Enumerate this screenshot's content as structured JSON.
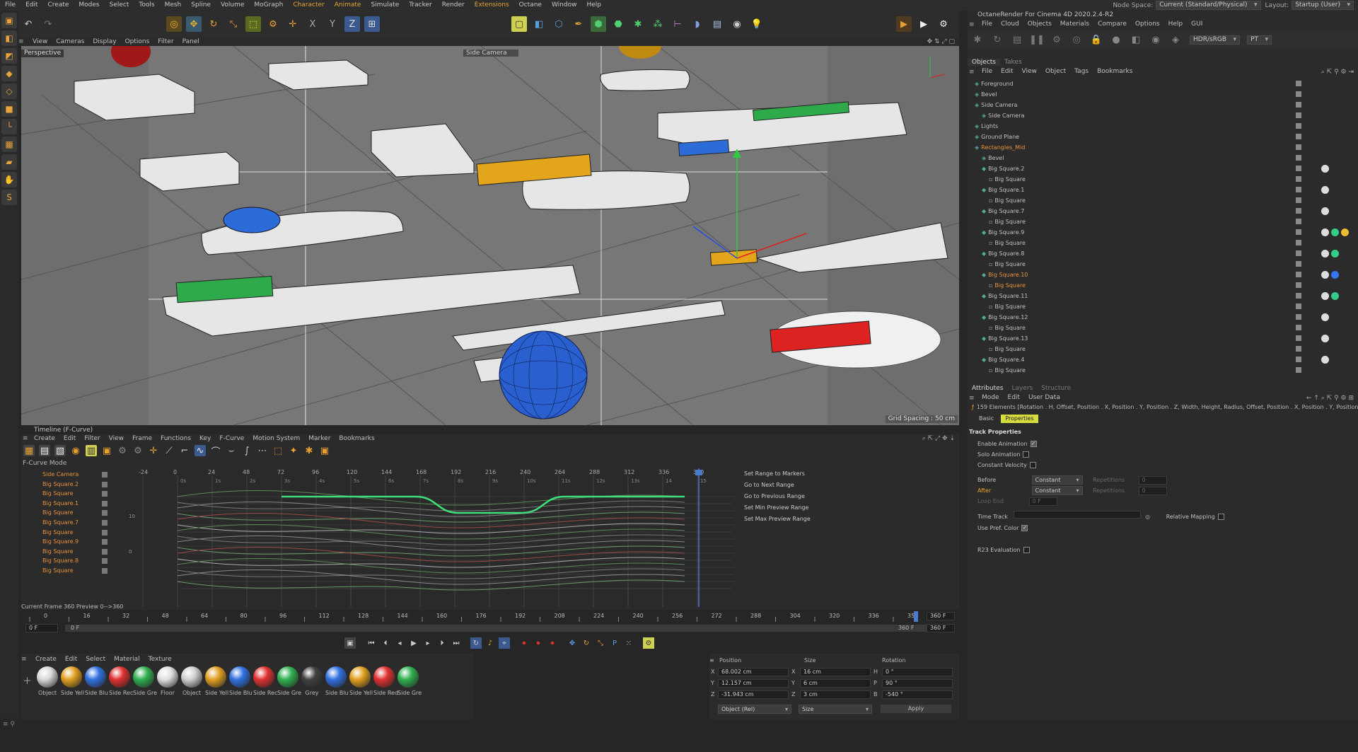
{
  "menubar": {
    "items": [
      "File",
      "Edit",
      "Create",
      "Modes",
      "Select",
      "Tools",
      "Mesh",
      "Spline",
      "Volume",
      "MoGraph",
      "Character",
      "Animate",
      "Simulate",
      "Tracker",
      "Render",
      "Extensions",
      "Octane",
      "Window",
      "Help"
    ],
    "nodespace_label": "Node Space:",
    "nodespace_value": "Current (Standard/Physical)",
    "layout_label": "Layout:",
    "layout_value": "Startup (User)"
  },
  "viewport": {
    "menu": [
      "View",
      "Cameras",
      "Display",
      "Options",
      "Filter",
      "Panel"
    ],
    "label": "Perspective",
    "camera": "Side Camera",
    "grid_spacing": "Grid Spacing : 50 cm"
  },
  "timeline": {
    "title": "Timeline (F-Curve)",
    "menu": [
      "Create",
      "Edit",
      "Filter",
      "View",
      "Frame",
      "Functions",
      "Key",
      "F-Curve",
      "Motion System",
      "Marker",
      "Bookmarks"
    ],
    "mode": "F-Curve Mode",
    "tracks": [
      "Side Camera",
      "Big Square.2",
      "Big Square",
      "Big Square.1",
      "Big Square",
      "Big Square.7",
      "Big Square",
      "Big Square.9",
      "Big Square",
      "Big Square.8",
      "Big Square"
    ],
    "top_ticks": [
      "-24",
      "0",
      "24",
      "48",
      "72",
      "96",
      "120",
      "144",
      "168",
      "192",
      "216",
      "240",
      "264",
      "288",
      "312",
      "336",
      "360"
    ],
    "sec_ticks": [
      "0s",
      "1s",
      "2s",
      "3s",
      "4s",
      "5s",
      "6s",
      "7s",
      "8s",
      "9s",
      "10s",
      "11s",
      "12s",
      "13s",
      "14",
      "15"
    ],
    "y_ticks": [
      "10",
      "0"
    ],
    "side_actions": [
      "Set Range to Markers",
      "Go to Next Range",
      "Go to Previous Range",
      "Set Min Preview Range",
      "Set Max Preview Range"
    ],
    "frame_info": "Current Frame  360  Preview  0-->360",
    "ruler_ticks": [
      "0",
      "16",
      "32",
      "48",
      "64",
      "80",
      "96",
      "112",
      "128",
      "144",
      "160",
      "176",
      "192",
      "208",
      "224",
      "240",
      "256",
      "272",
      "288",
      "304",
      "320",
      "336",
      "352"
    ],
    "ruler_end": "360 F",
    "start_field": "0 F",
    "preview_start": "0 F",
    "preview_end": "360 F",
    "end_field": "360 F"
  },
  "materials": {
    "menu": [
      "Create",
      "Edit",
      "Select",
      "Material",
      "Texture"
    ],
    "items": [
      {
        "name": "Object",
        "color": "#d8d8d8"
      },
      {
        "name": "Side Yell",
        "color": "#e0a020"
      },
      {
        "name": "Side Blu",
        "color": "#3070e0"
      },
      {
        "name": "Side Rec",
        "color": "#e03030"
      },
      {
        "name": "Side Gre",
        "color": "#30b050"
      },
      {
        "name": "Floor",
        "color": "#e0e0e0"
      },
      {
        "name": "Object",
        "color": "#d0d0d0"
      },
      {
        "name": "Side Yell",
        "color": "#e0a020"
      },
      {
        "name": "Side Blu",
        "color": "#3070e0"
      },
      {
        "name": "Side Rec",
        "color": "#e03030"
      },
      {
        "name": "Side Gre",
        "color": "#30b050"
      },
      {
        "name": "Grey",
        "color": "#404040"
      },
      {
        "name": "Side Blu",
        "color": "#3070e0"
      },
      {
        "name": "Side Yell",
        "color": "#e0a020"
      },
      {
        "name": "Side Red",
        "color": "#e03030"
      },
      {
        "name": "Side Gre",
        "color": "#30b050"
      }
    ]
  },
  "coords": {
    "headers": [
      "Position",
      "Size",
      "Rotation"
    ],
    "rows": [
      {
        "axis": "X",
        "pos": "68.002 cm",
        "saxis": "X",
        "size": "16 cm",
        "raxis": "H",
        "rot": "0 °"
      },
      {
        "axis": "Y",
        "pos": "12.157 cm",
        "saxis": "Y",
        "size": "6 cm",
        "raxis": "P",
        "rot": "90 °"
      },
      {
        "axis": "Z",
        "pos": "-31.943 cm",
        "saxis": "Z",
        "size": "3 cm",
        "raxis": "B",
        "rot": "-540 °"
      }
    ],
    "mode": "Object (Rel)",
    "size_mode": "Size",
    "apply": "Apply"
  },
  "octane": {
    "title": "OctaneRender For Cinema 4D 2020.2.4-R2",
    "menu": [
      "File",
      "Cloud",
      "Objects",
      "Materials",
      "Compare",
      "Options",
      "Help",
      "GUI"
    ],
    "color_space": "HDR/sRGB",
    "kernel": "PT"
  },
  "objects": {
    "tabs": [
      "Objects",
      "Takes"
    ],
    "menu": [
      "File",
      "Edit",
      "View",
      "Object",
      "Tags",
      "Bookmarks"
    ],
    "rows": [
      {
        "name": "Foreground",
        "indent": 0
      },
      {
        "name": "Bevel",
        "indent": 0
      },
      {
        "name": "Side Camera",
        "indent": 0
      },
      {
        "name": "Side Camera",
        "indent": 1
      },
      {
        "name": "Lights",
        "indent": 0
      },
      {
        "name": "Ground Plane",
        "indent": 0
      },
      {
        "name": "Rectangles_Mid",
        "indent": 0,
        "hl": true
      },
      {
        "name": "Bevel",
        "indent": 1
      },
      {
        "name": "Big Square.2",
        "indent": 1
      },
      {
        "name": "Big Square",
        "indent": 2
      },
      {
        "name": "Big Square.1",
        "indent": 1
      },
      {
        "name": "Big Square",
        "indent": 2
      },
      {
        "name": "Big Square.7",
        "indent": 1
      },
      {
        "name": "Big Square",
        "indent": 2
      },
      {
        "name": "Big Square.9",
        "indent": 1
      },
      {
        "name": "Big Square",
        "indent": 2
      },
      {
        "name": "Big Square.8",
        "indent": 1
      },
      {
        "name": "Big Square",
        "indent": 2
      },
      {
        "name": "Big Square.10",
        "indent": 1,
        "hl": true
      },
      {
        "name": "Big Square",
        "indent": 2,
        "hl": true
      },
      {
        "name": "Big Square.11",
        "indent": 1
      },
      {
        "name": "Big Square",
        "indent": 2
      },
      {
        "name": "Big Square.12",
        "indent": 1
      },
      {
        "name": "Big Square",
        "indent": 2
      },
      {
        "name": "Big Square.13",
        "indent": 1
      },
      {
        "name": "Big Square",
        "indent": 2
      },
      {
        "name": "Big Square.4",
        "indent": 1
      },
      {
        "name": "Big Square",
        "indent": 2
      }
    ]
  },
  "attributes": {
    "tabs": [
      "Attributes",
      "Layers",
      "Structure"
    ],
    "menu": [
      "Mode",
      "Edit",
      "User Data"
    ],
    "selection": "159 Elements [Rotation . H, Offset, Position . X, Position . Y, Position . Z, Width, Height, Radius, Offset, Position . X, Position . Y, Position . Z, Width, He",
    "btabs": [
      "Basic",
      "Properties"
    ],
    "section": "Track Properties",
    "enable_animation": "Enable Animation",
    "solo_animation": "Solo Animation",
    "constant_velocity": "Constant Velocity",
    "before": "Before",
    "before_val": "Constant",
    "after": "After",
    "after_val": "Constant",
    "repetitions": "Repetitions",
    "rep_val": "0",
    "loop_end": "Loop End",
    "loop_val": "0 F",
    "time_track": "Time Track",
    "relative_mapping": "Relative Mapping",
    "use_pref_color": "Use Pref. Color",
    "r23_eval": "R23 Evaluation"
  }
}
